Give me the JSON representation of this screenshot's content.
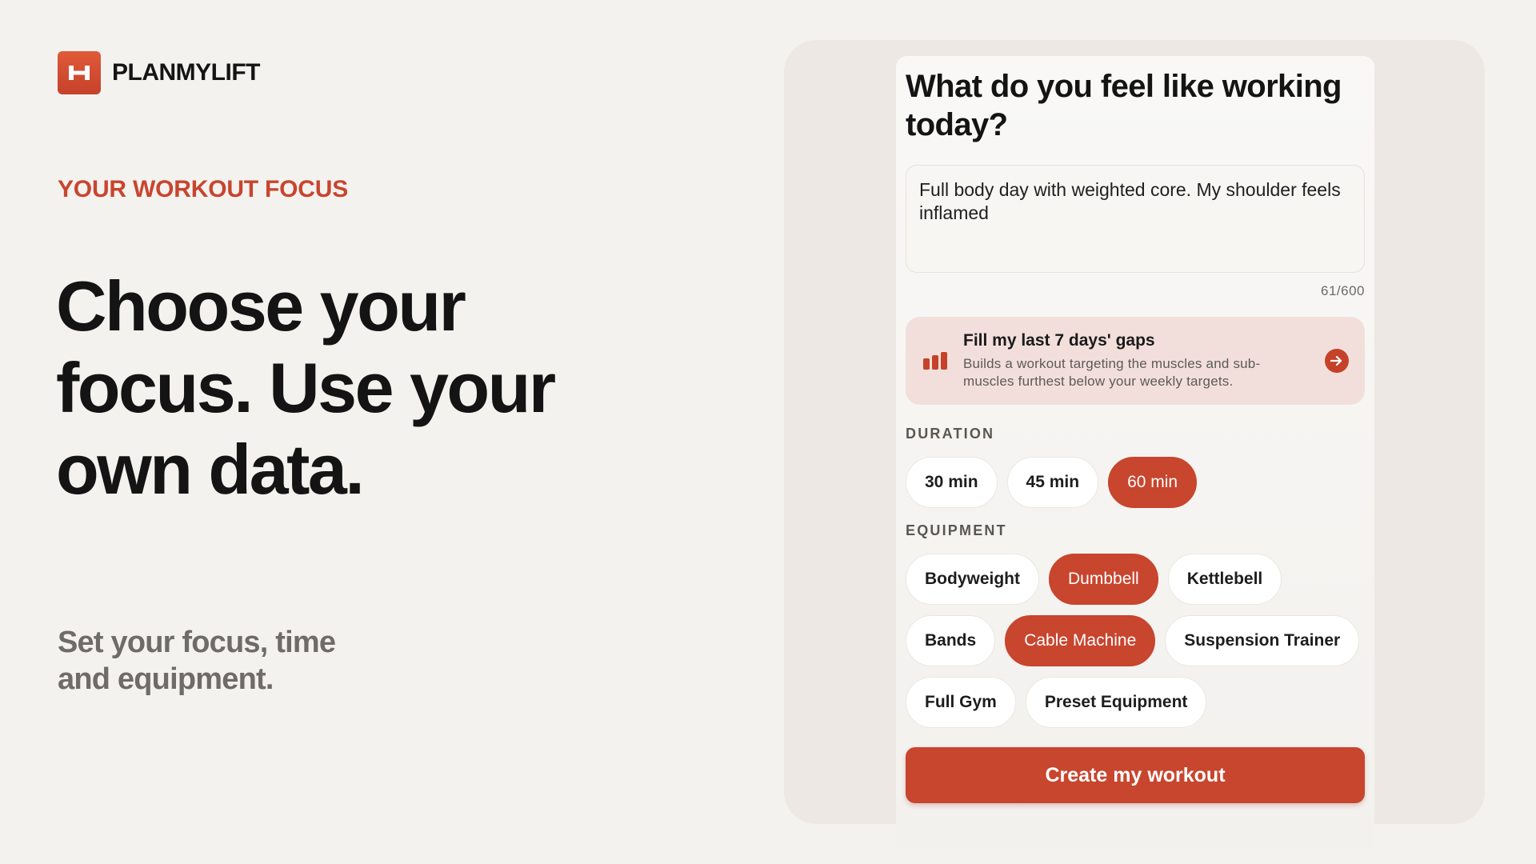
{
  "brand": {
    "name": "PLANMYLIFT",
    "logo_icon": "planmylift-logo-icon",
    "accent": "#c8452e"
  },
  "hero": {
    "eyebrow": "YOUR WORKOUT FOCUS",
    "headline": "Choose your focus. Use your own data.",
    "subline": "Set your focus, time and equipment."
  },
  "form": {
    "question": "What do you feel like working today?",
    "prompt_value": "Full body day with weighted core. My shoulder feels inflamed",
    "char_count": "61/600",
    "gap_card": {
      "title": "Fill my last 7 days' gaps",
      "description": "Builds a workout targeting the muscles and sub-muscles furthest below your weekly targets.",
      "icon": "bar-chart-icon",
      "arrow_icon": "arrow-right-circle-icon"
    },
    "duration": {
      "label": "DURATION",
      "options": [
        {
          "label": "30 min",
          "selected": false
        },
        {
          "label": "45 min",
          "selected": false
        },
        {
          "label": "60 min",
          "selected": true
        }
      ]
    },
    "equipment": {
      "label": "EQUIPMENT",
      "options": [
        {
          "label": "Bodyweight",
          "selected": false
        },
        {
          "label": "Dumbbell",
          "selected": true
        },
        {
          "label": "Kettlebell",
          "selected": false
        },
        {
          "label": "Bands",
          "selected": false
        },
        {
          "label": "Cable Machine",
          "selected": true
        },
        {
          "label": "Suspension Trainer",
          "selected": false
        },
        {
          "label": "Full Gym",
          "selected": false
        },
        {
          "label": "Preset Equipment",
          "selected": false
        }
      ]
    },
    "cta_label": "Create my workout"
  }
}
